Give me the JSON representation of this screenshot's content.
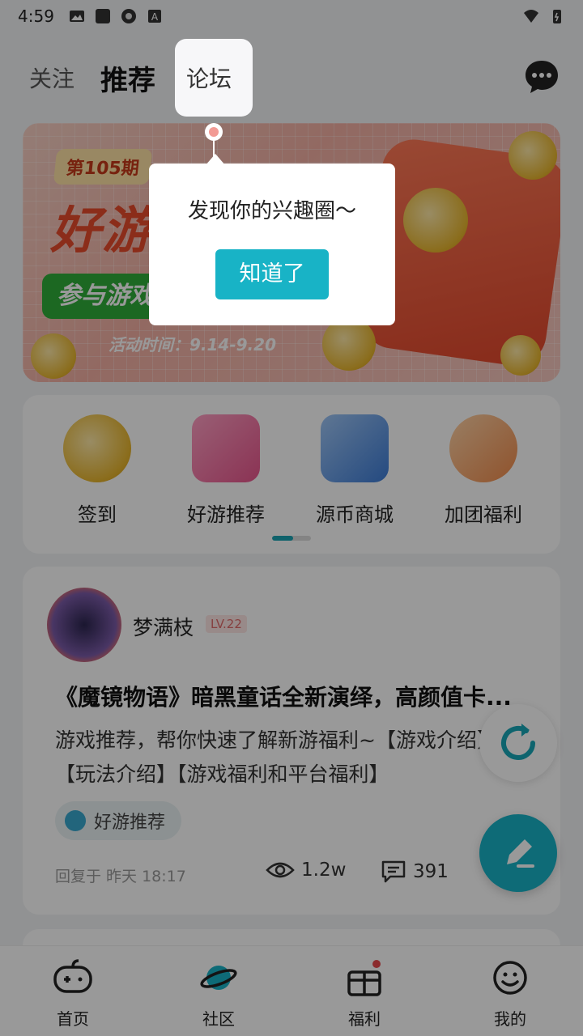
{
  "status_bar": {
    "time": "4:59"
  },
  "top_tabs": {
    "follow": "关注",
    "recommend": "推荐",
    "forum": "论坛"
  },
  "banner": {
    "period": "第105期",
    "title": "好游",
    "green_tag": "参与游戏",
    "activity_time": "活动时间：9.14-9.20"
  },
  "quick_entries": [
    {
      "label": "签到",
      "icon": "coin-icon"
    },
    {
      "label": "好游推荐",
      "icon": "game-recommend-icon"
    },
    {
      "label": "源币商城",
      "icon": "exchange-icon"
    },
    {
      "label": "加团福利",
      "icon": "welfare-cat-icon"
    }
  ],
  "post": {
    "username": "梦满枝",
    "level": "LV.22",
    "title": "《魔镜物语》暗黑童话全新演绎，高颜值卡...",
    "body": "游戏推荐，帮你快速了解新游福利~【游戏介绍】【玩法介绍】【游戏福利和平台福利】",
    "tag": "好游推荐",
    "reply_time": "回复于 昨天 18:17",
    "views": "1.2w",
    "comments": "391"
  },
  "bottom_nav": [
    {
      "label": "首页",
      "icon": "gamepad-icon"
    },
    {
      "label": "社区",
      "icon": "planet-icon"
    },
    {
      "label": "福利",
      "icon": "gift-icon"
    },
    {
      "label": "我的",
      "icon": "smile-face-icon"
    }
  ],
  "guide_popup": {
    "message": "发现你的兴趣圈～",
    "button": "知道了"
  },
  "colors": {
    "accent": "#18b3c6",
    "level_red": "#e06b6b",
    "overlay": "rgba(0,0,0,0.40)"
  }
}
